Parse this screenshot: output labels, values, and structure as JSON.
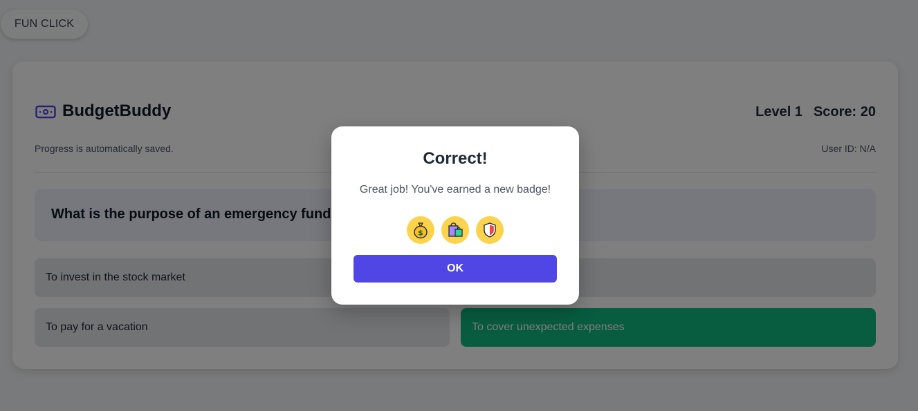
{
  "top_button": {
    "label": "FUN CLICK"
  },
  "header": {
    "brand": "BudgetBuddy",
    "level": "Level 1",
    "score": "Score: 20",
    "saved_note": "Progress is automatically saved.",
    "user_id": "User ID: N/A"
  },
  "question": {
    "text": "What is the purpose of an emergency fund?"
  },
  "answers": [
    {
      "label": "To invest in the stock market",
      "state": "default"
    },
    {
      "label": "",
      "state": "default"
    },
    {
      "label": "To pay for a vacation",
      "state": "default"
    },
    {
      "label": "To cover unexpected expenses",
      "state": "correct"
    }
  ],
  "modal": {
    "title": "Correct!",
    "message": "Great job! You've earned a new badge!",
    "badges": [
      "money-bag-icon",
      "shopping-bag-icon",
      "shield-icon"
    ],
    "ok_label": "OK"
  },
  "colors": {
    "accent": "#4f46e5",
    "correct": "#10b981",
    "badge_bg": "#fcd34d",
    "question_bg": "#eef0fd"
  }
}
